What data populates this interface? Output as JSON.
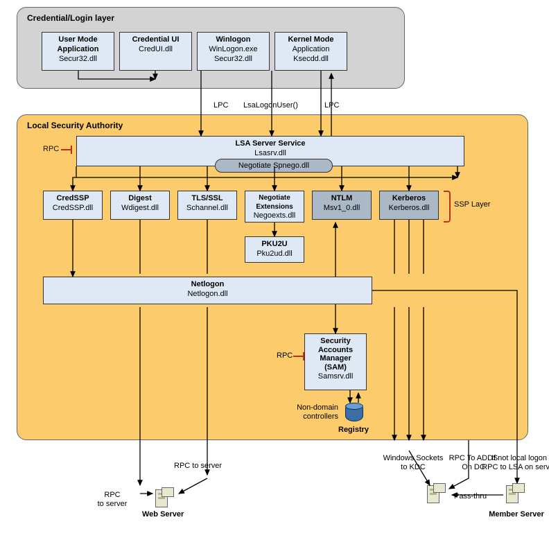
{
  "panels": {
    "cred_layer": "Credential/Login layer",
    "lsa": "Local Security Authority"
  },
  "cred_boxes": {
    "usermode": {
      "t": "User Mode\nApplication",
      "s": "Secur32.dll"
    },
    "credui": {
      "t": "Credential UI",
      "s": "CredUI.dll"
    },
    "winlogon": {
      "t": "Winlogon",
      "s": "WinLogon.exe\nSecur32.dll"
    },
    "kernel": {
      "t": "Kernel Mode",
      "s": "Application\nKsecdd.dll"
    }
  },
  "lsa_server": {
    "t": "LSA Server Service",
    "s": "Lsasrv.dll"
  },
  "negotiate_pill": "Negotiate Spnego.dll",
  "ssp": {
    "credssp": {
      "t": "CredSSP",
      "s": "CredSSP.dll"
    },
    "digest": {
      "t": "Digest",
      "s": "Wdigest.dll"
    },
    "tls": {
      "t": "TLS/SSL",
      "s": "Schannel.dll"
    },
    "negoext": {
      "t": "Negotiate\nExtensions",
      "s": "Negoexts.dll"
    },
    "ntlm": {
      "t": "NTLM",
      "s": "Msv1_0.dll"
    },
    "kerb": {
      "t": "Kerberos",
      "s": "Kerberos.dll"
    }
  },
  "pku2u": {
    "t": "PKU2U",
    "s": "Pku2ud.dll"
  },
  "netlogon": {
    "t": "Netlogon",
    "s": "Netlogon.dll"
  },
  "sam": {
    "t": "Security\nAccounts\nManager\n(SAM)",
    "s": "Samsrv.dll"
  },
  "labels": {
    "lpc1": "LPC",
    "lsalogon": "LsaLogonUser()",
    "lpc2": "LPC",
    "rpc1": "RPC",
    "ssp_layer": "SSP Layer",
    "rpc2": "RPC",
    "nondomain": "Non-domain\ncontrollers",
    "registry": "Registry",
    "rpc_to_server_a": "RPC to server",
    "rpc_to_server_b": "RPC\nto server",
    "webserver": "Web Server",
    "sockets": "Windows Sockets\nto KDC",
    "rpc_adds": "RPC To ADDS\nOn DC",
    "passthru": "Pass-thru",
    "notlocal": "If not local logon\nRPC to LSA  on server",
    "member": "Member Server"
  }
}
